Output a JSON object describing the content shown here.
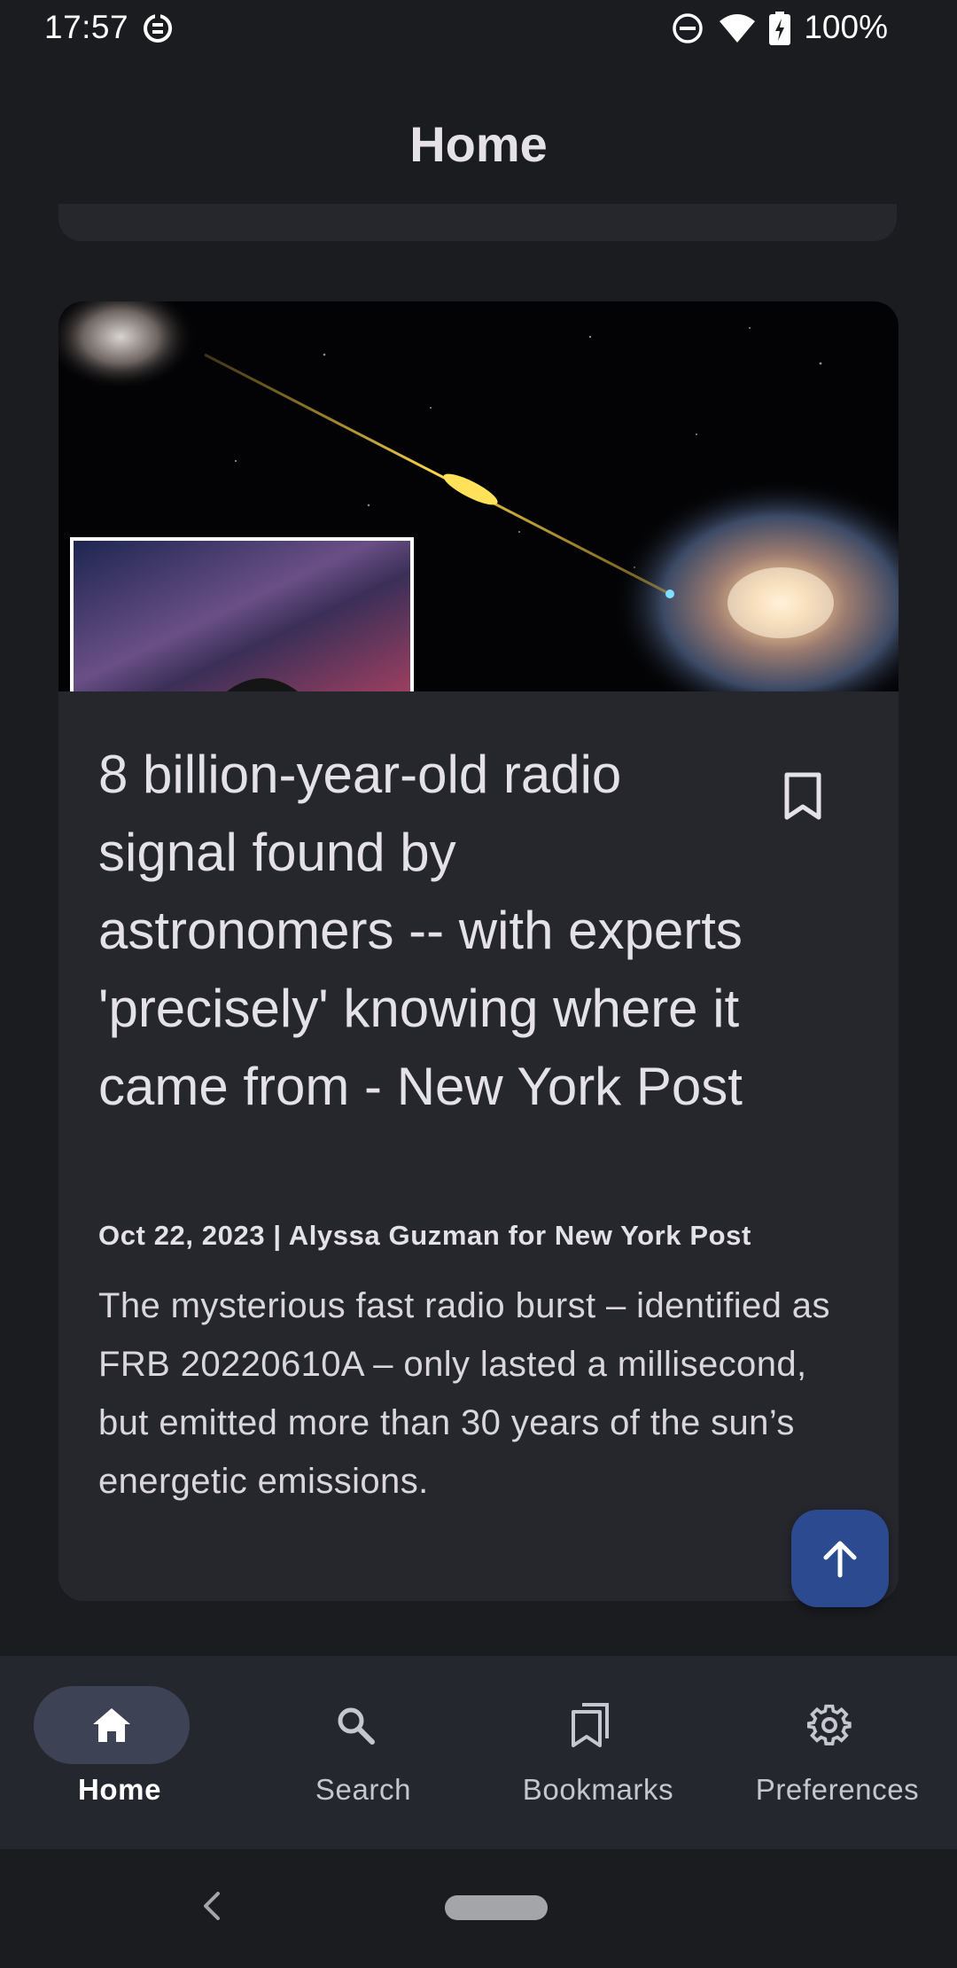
{
  "status_bar": {
    "time": "17:57",
    "battery": "100%",
    "icons": [
      "data-saver-icon",
      "dnd-icon",
      "wifi-icon",
      "battery-charging-icon"
    ]
  },
  "app_bar": {
    "title": "Home"
  },
  "article": {
    "title": "8 billion-year-old radio signal found by astronomers -- with experts 'precisely' knowing where it came from - New York Post",
    "meta": "Oct 22, 2023 | Alyssa Guzman for New York Post",
    "description": "The mysterious fast radio burst – identified as FRB 20220610A – only lasted a millisecond, but emitted more than 30 years of the sun’s energetic emissions.",
    "bookmark_icon": "bookmark-outline-icon",
    "image_icon": "article-image"
  },
  "fab": {
    "icon": "arrow-up-icon"
  },
  "bottom_nav": {
    "items": [
      {
        "label": "Home",
        "icon": "home-icon",
        "active": true
      },
      {
        "label": "Search",
        "icon": "search-icon",
        "active": false
      },
      {
        "label": "Bookmarks",
        "icon": "bookmarks-icon",
        "active": false
      },
      {
        "label": "Preferences",
        "icon": "gear-icon",
        "active": false
      }
    ]
  },
  "colors": {
    "background": "#1b1c20",
    "card": "#26272d",
    "nav_bar": "#25272f",
    "nav_indicator": "#3d4254",
    "fab": "#2c4a8f",
    "text": "#e4e2e6"
  }
}
